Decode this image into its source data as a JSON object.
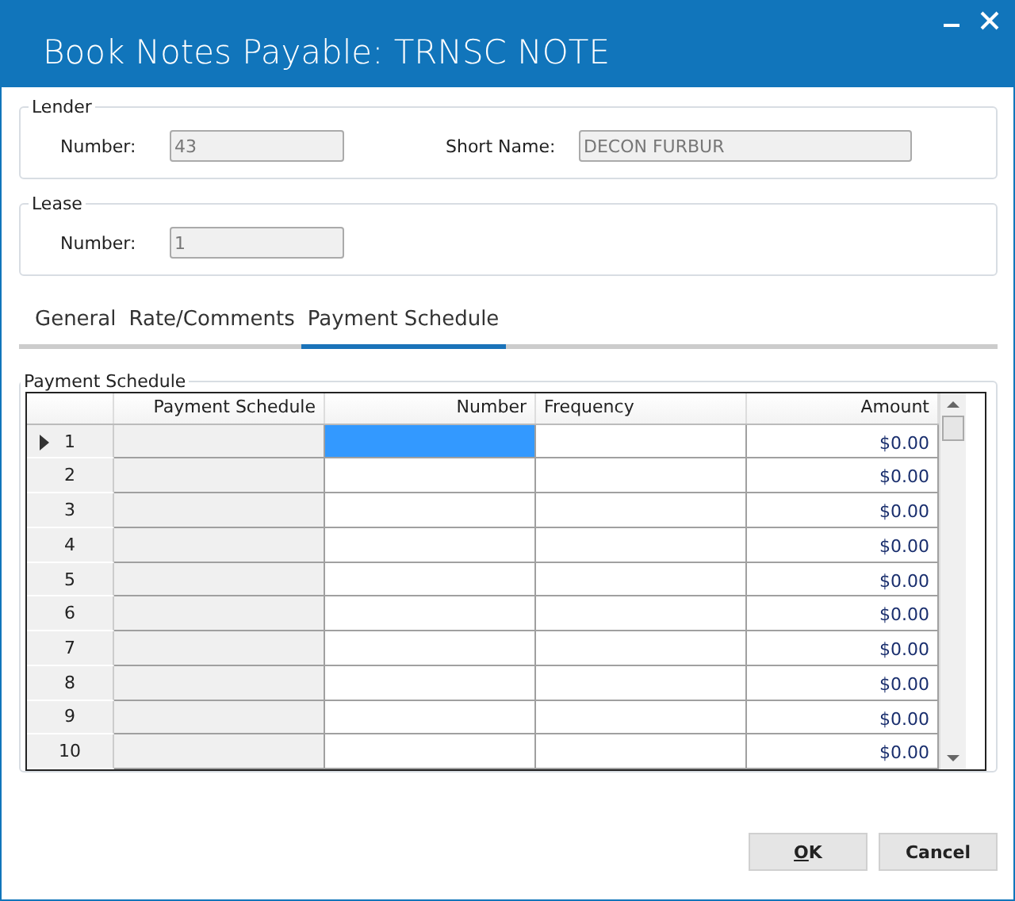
{
  "window": {
    "title": "Book Notes Payable: TRNSC NOTE"
  },
  "lender": {
    "legend": "Lender",
    "number_label": "Number:",
    "number": "43",
    "short_name_label": "Short Name:",
    "short_name": "DECON FURBUR"
  },
  "lease": {
    "legend": "Lease",
    "number_label": "Number:",
    "number": "1"
  },
  "tabs": [
    {
      "label": "General",
      "selected": false
    },
    {
      "label": "Rate/Comments",
      "selected": false
    },
    {
      "label": "Payment Schedule",
      "selected": true
    }
  ],
  "schedule": {
    "legend": "Payment Schedule",
    "columns": [
      "Payment Schedule",
      "Number",
      "Frequency",
      "Amount"
    ],
    "rows": [
      {
        "row": "1",
        "amount": "$0.00",
        "selected": true
      },
      {
        "row": "2",
        "amount": "$0.00",
        "selected": false
      },
      {
        "row": "3",
        "amount": "$0.00",
        "selected": false
      },
      {
        "row": "4",
        "amount": "$0.00",
        "selected": false
      },
      {
        "row": "5",
        "amount": "$0.00",
        "selected": false
      },
      {
        "row": "6",
        "amount": "$0.00",
        "selected": false
      },
      {
        "row": "7",
        "amount": "$0.00",
        "selected": false
      },
      {
        "row": "8",
        "amount": "$0.00",
        "selected": false
      },
      {
        "row": "9",
        "amount": "$0.00",
        "selected": false
      },
      {
        "row": "10",
        "amount": "$0.00",
        "selected": false
      }
    ]
  },
  "buttons": [
    {
      "label": "OK",
      "access_key_underlined": true
    },
    {
      "label": "Cancel",
      "access_key_underlined": false
    }
  ]
}
